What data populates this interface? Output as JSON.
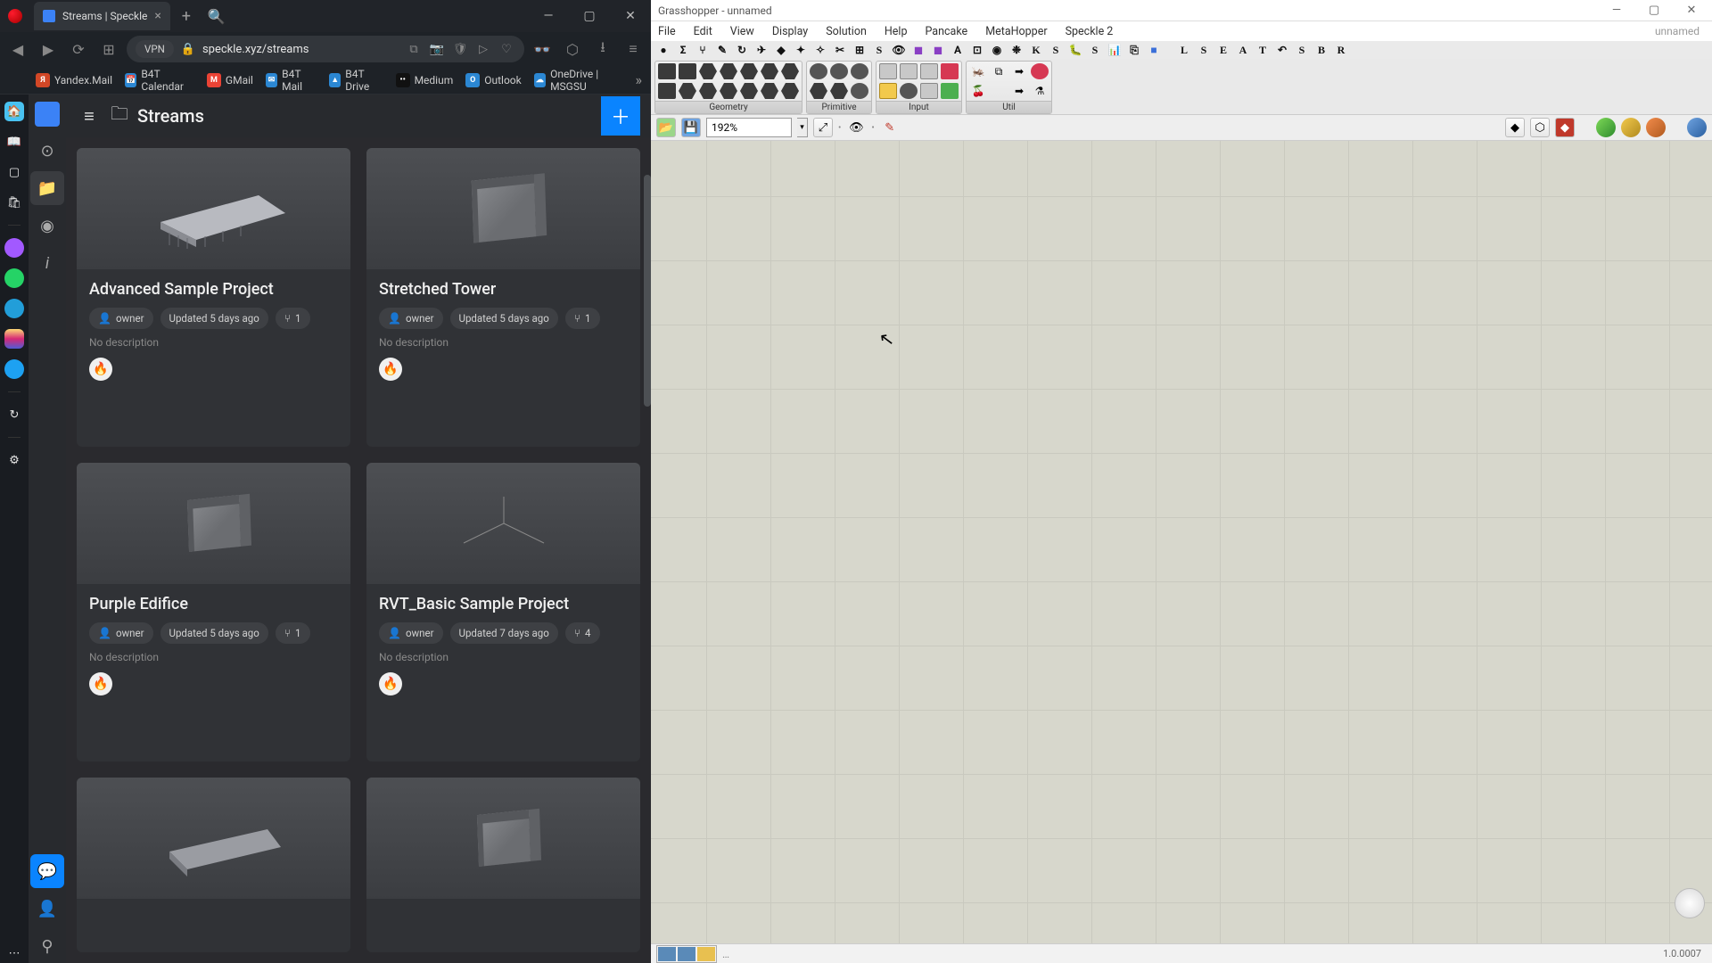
{
  "browser": {
    "tab_title": "Streams | Speckle",
    "url_display": "speckle.xyz/streams",
    "vpn_label": "VPN",
    "bookmarks": [
      {
        "label": "Yandex.Mail",
        "color": "#d24726",
        "initial": "Я"
      },
      {
        "label": "B4T Calendar",
        "color": "#2b87d3",
        "initial": "📅"
      },
      {
        "label": "GMail",
        "color": "#ea4335",
        "initial": "M"
      },
      {
        "label": "B4T Mail",
        "color": "#2b87d3",
        "initial": "✉"
      },
      {
        "label": "B4T Drive",
        "color": "#2b87d3",
        "initial": "▲"
      },
      {
        "label": "Medium",
        "color": "#111",
        "initial": "M"
      },
      {
        "label": "Outlook",
        "color": "#2b87d3",
        "initial": "O"
      },
      {
        "label": "OneDrive | MSGSU",
        "color": "#2b87d3",
        "initial": "☁"
      }
    ]
  },
  "page": {
    "title": "Streams",
    "no_description": "No description",
    "streams": [
      {
        "title": "Advanced Sample Project",
        "role": "owner",
        "updated": "Updated 5 days ago",
        "branches": "1"
      },
      {
        "title": "Stretched Tower",
        "role": "owner",
        "updated": "Updated 5 days ago",
        "branches": "1"
      },
      {
        "title": "Purple Edifice",
        "role": "owner",
        "updated": "Updated 5 days ago",
        "branches": "1"
      },
      {
        "title": "RVT_Basic Sample Project",
        "role": "owner",
        "updated": "Updated 7 days ago",
        "branches": "4"
      }
    ]
  },
  "gh": {
    "title": "Grasshopper - unnamed",
    "doc_label": "unnamed",
    "menus": [
      "File",
      "Edit",
      "View",
      "Display",
      "Solution",
      "Help",
      "Pancake",
      "MetaHopper",
      "Speckle 2"
    ],
    "ribbon_groups": [
      "Geometry",
      "Primitive",
      "Input",
      "Util"
    ],
    "zoom": "192%",
    "version": "1.0.0007",
    "shortcut_letters": [
      "K",
      "S",
      "S",
      "L",
      "S",
      "E",
      "A",
      "T",
      "S",
      "B",
      "R"
    ]
  }
}
